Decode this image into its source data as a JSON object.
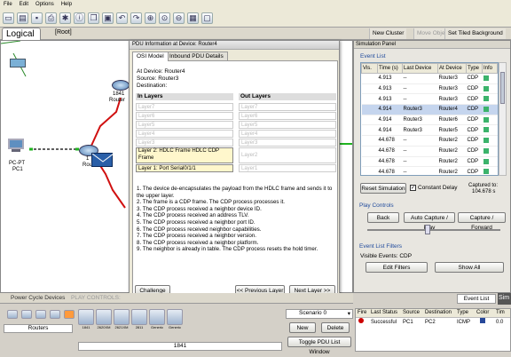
{
  "menu": [
    "File",
    "Edit",
    "Options",
    "Help"
  ],
  "toolbar_icons": [
    "new-icon",
    "open-icon",
    "save-icon",
    "print-icon",
    "wizard-icon",
    "network-info-icon",
    "copy-icon",
    "paste-icon",
    "undo-icon",
    "redo-icon",
    "zoom-in-icon",
    "zoom-icon",
    "zoom-out-icon",
    "palette-icon",
    "custom-device-icon"
  ],
  "workspace": {
    "tab": "Logical",
    "root": "[Root]",
    "new_cluster": "New Cluster",
    "move_object": "Move Object",
    "set_background": "Set Tiled Background"
  },
  "canvas": {
    "router_1841": "1841",
    "router_label": "Router",
    "pc_type": "PC-PT",
    "pc_name": "PC1",
    "router4_a": "1",
    "router4_b": "Route"
  },
  "popup": {
    "title": "PDU Information at Device: Router4",
    "tabs": [
      "OSI Model",
      "Inbound PDU Details"
    ],
    "at_device": "At Device: Router4",
    "source": "Source: Router3",
    "destination": "Destination:",
    "in_layers": "In Layers",
    "out_layers": "Out Layers",
    "in_layer_items": [
      "Layer7",
      "Layer6",
      "Layer5",
      "Layer4",
      "Layer3"
    ],
    "in_layer2": "Layer 2: HDLC Frame HDLC CDP Frame",
    "in_layer1": "Layer 1: Port Serial0/1/1",
    "out_layer_items": [
      "Layer7",
      "Layer6",
      "Layer5",
      "Layer4",
      "Layer3",
      "Layer2",
      "Layer1"
    ],
    "description": [
      "1. The device de-encapsulates the payload from the HDLC frame and sends it to the upper layer.",
      "2. The frame is a CDP frame. The CDP process processes it.",
      "3. The CDP process received a neighbor device ID.",
      "4. The CDP process received an address TLV.",
      "5. The CDP process received a neighbor port ID.",
      "6. The CDP process received neighbor capabilities.",
      "7. The CDP process received a neighbor version.",
      "8. The CDP process received a neighbor platform.",
      "9. The neighbor is already in table. The CDP process resets the hold timer."
    ],
    "challenge": "Challenge Me",
    "prev": "<< Previous Layer",
    "next": "Next Layer >>"
  },
  "sim": {
    "title": "Simulation Panel",
    "event_list": "Event List",
    "headers": [
      "Vis.",
      "Time (s)",
      "Last Device",
      "At Device",
      "Type",
      "Info"
    ],
    "events": [
      {
        "time": "4.913",
        "last": "--",
        "at": "Router3",
        "type": "CDP",
        "color": "#3bb36b"
      },
      {
        "time": "4.913",
        "last": "--",
        "at": "Router3",
        "type": "CDP",
        "color": "#3bb36b"
      },
      {
        "time": "4.913",
        "last": "--",
        "at": "Router3",
        "type": "CDP",
        "color": "#3bb36b"
      },
      {
        "time": "4.914",
        "last": "Router3",
        "at": "Router4",
        "type": "CDP",
        "color": "#3bb36b"
      },
      {
        "time": "4.914",
        "last": "Router3",
        "at": "Router6",
        "type": "CDP",
        "color": "#3bb36b"
      },
      {
        "time": "4.914",
        "last": "Router3",
        "at": "Router5",
        "type": "CDP",
        "color": "#3bb36b"
      },
      {
        "time": "44.678",
        "last": "--",
        "at": "Router2",
        "type": "CDP",
        "color": "#3bb36b"
      },
      {
        "time": "44.678",
        "last": "--",
        "at": "Router2",
        "type": "CDP",
        "color": "#3bb36b"
      },
      {
        "time": "44.678",
        "last": "--",
        "at": "Router2",
        "type": "CDP",
        "color": "#3bb36b"
      },
      {
        "time": "44.678",
        "last": "--",
        "at": "Router2",
        "type": "CDP",
        "color": "#3bb36b"
      }
    ],
    "reset": "Reset Simulation",
    "constant_delay": "Constant Delay",
    "captured_to": "Captured to:",
    "captured_value": "104.678 s",
    "play_controls": "Play Controls",
    "back": "Back",
    "auto_capture": "Auto Capture / Play",
    "capture_forward": "Capture / Forward",
    "filters": "Event List Filters",
    "visible_events": "Visible Events: CDP",
    "edit_filters": "Edit Filters",
    "show_all": "Show All"
  },
  "bottom": {
    "power_cycle": "Power Cycle Devices",
    "play_controls": "PLAY CONTROLS:",
    "event_list": "Event List",
    "sim_tab": "Sim",
    "category": "Routers",
    "devices": [
      "1841",
      "2620XM",
      "2621XM",
      "2811",
      "Generic",
      "Generic"
    ],
    "selected_device": "1841",
    "scenario": "Scenario 0",
    "new": "New",
    "delete": "Delete",
    "toggle": "Toggle PDU List Window",
    "pdu_headers": [
      "Fire",
      "Last Status",
      "Source",
      "Destination",
      "Type",
      "Color",
      "Tim"
    ],
    "pdu_row": {
      "status": "Successful",
      "source": "PC1",
      "dest": "PC2",
      "type": "ICMP",
      "time": "0.0"
    }
  }
}
